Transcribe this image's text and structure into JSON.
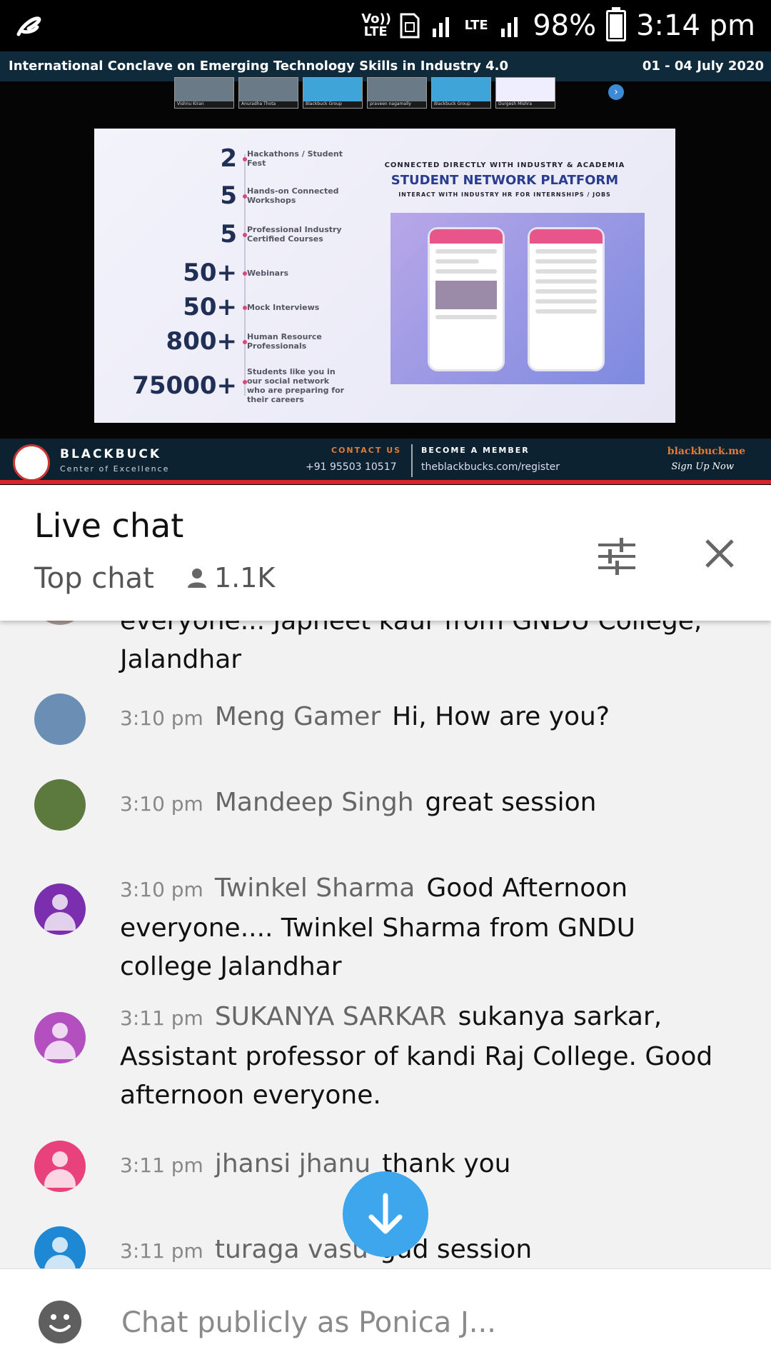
{
  "status_bar": {
    "network_voice": "Vo)) LTE",
    "network_data": "LTE",
    "battery": "98%",
    "time": "3:14 pm",
    "icons": [
      "app-logo-icon",
      "sim-icon",
      "signal-icon",
      "battery-icon"
    ]
  },
  "video": {
    "banner_title": "International Conclave on Emerging Technology Skills in Industry 4.0",
    "banner_dates": "01 - 04 July 2020",
    "participants": [
      "Vishnu Kiran",
      "Anuradha Thota",
      "Blackbuck Group",
      "praveen nagamally",
      "Blackbuck Group",
      "Durgesh Mishra"
    ],
    "slide": {
      "stats": [
        {
          "num": "2",
          "label": "Hackathons / Student Fest"
        },
        {
          "num": "5",
          "label": "Hands-on Connected Workshops"
        },
        {
          "num": "5",
          "label": "Professional Industry Certified Courses"
        },
        {
          "num": "50+",
          "label": "Webinars"
        },
        {
          "num": "50+",
          "label": "Mock Interviews"
        },
        {
          "num": "800+",
          "label": "Human Resource Professionals"
        },
        {
          "num": "75000+",
          "label": "Students like you in our social network who are preparing for their careers"
        }
      ],
      "platform_kicker": "CONNECTED DIRECTLY WITH INDUSTRY & ACADEMIA",
      "platform_title": "STUDENT NETWORK PLATFORM",
      "platform_sub": "INTERACT WITH INDUSTRY HR FOR INTERNSHIPS / JOBS"
    },
    "footer": {
      "brand": "BLACKBUCK",
      "brand_sub": "Center of Excellence",
      "contact_label": "CONTACT US",
      "contact_phone": "+91 95503 10517",
      "member_label": "BECOME A MEMBER",
      "member_url": "theblackbucks.com/register",
      "site": "blackbuck.me",
      "signup": "Sign Up Now"
    }
  },
  "chat": {
    "title": "Live chat",
    "mode": "Top chat",
    "viewers": "1.1K",
    "messages": [
      {
        "time": "",
        "author": "",
        "text": "everyone... Japneet kaur from GNDU College, Jalandhar",
        "avatar_color": "#a89a94"
      },
      {
        "time": "3:10 pm",
        "author": "Meng Gamer",
        "text": "Hi, How are you?",
        "avatar_color": "#6b8fb4"
      },
      {
        "time": "3:10 pm",
        "author": "Mandeep Singh",
        "text": "great session",
        "avatar_color": "#5d7a3e"
      },
      {
        "time": "3:10 pm",
        "author": "Twinkel Sharma",
        "text": "Good Afternoon everyone.... Twinkel Sharma from GNDU college Jalandhar",
        "avatar_color": "#7b2fae"
      },
      {
        "time": "3:11 pm",
        "author": "SUKANYA SARKAR",
        "text": "sukanya sarkar, Assistant professor of kandi Raj College. Good afternoon everyone.",
        "avatar_color": "#b44fc0"
      },
      {
        "time": "3:11 pm",
        "author": "jhansi jhanu",
        "text": "thank you",
        "avatar_color": "#e8417b"
      },
      {
        "time": "3:11 pm",
        "author": "turaga vasu",
        "text": "gud session",
        "avatar_color": "#1e88d4"
      }
    ],
    "input_placeholder": "Chat publicly as Ponica J..."
  },
  "colors": {
    "accent_blue": "#3ea6ec",
    "video_bar": "#0c2230",
    "red_progress": "#d9252a"
  }
}
